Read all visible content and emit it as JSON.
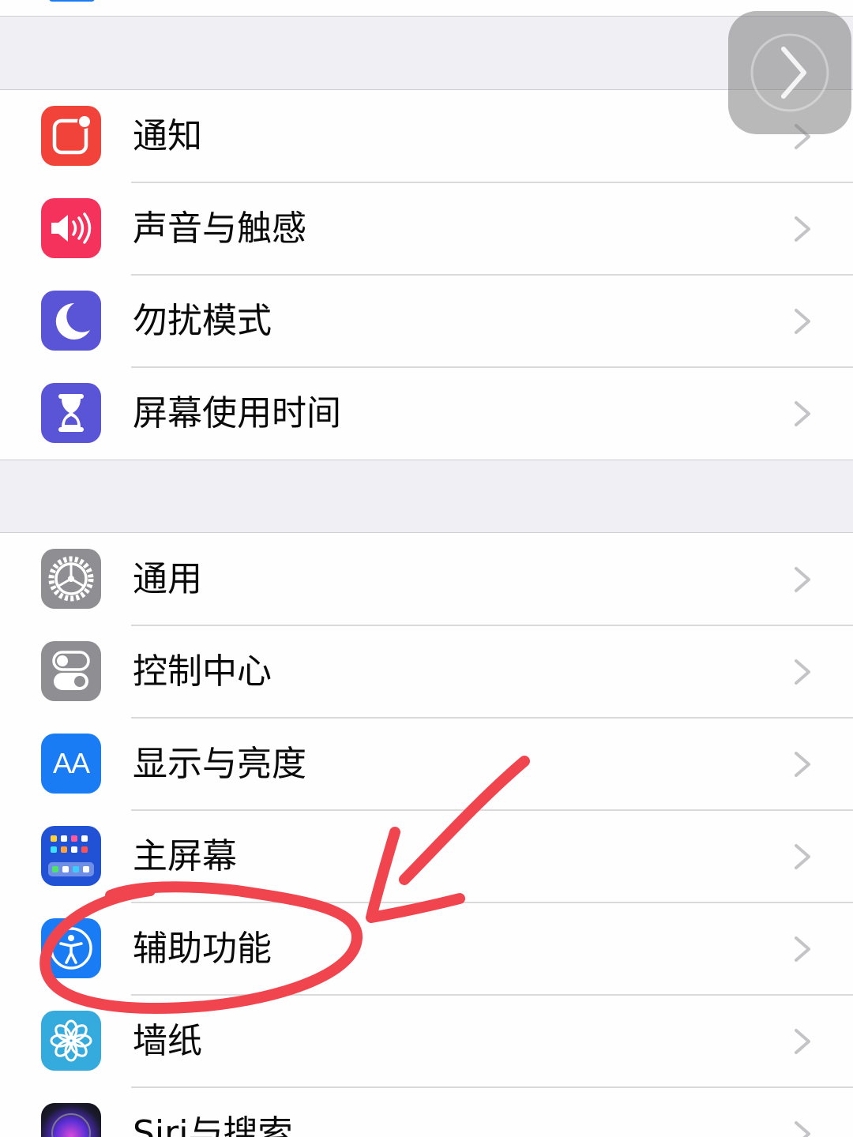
{
  "groups": [
    {
      "rows": [
        {
          "label": "通知",
          "icon": "notifications-icon",
          "color": "#f2433a"
        },
        {
          "label": "声音与触感",
          "icon": "speaker-icon",
          "color": "#f5325b"
        },
        {
          "label": "勿扰模式",
          "icon": "moon-icon",
          "color": "#5a55d6"
        },
        {
          "label": "屏幕使用时间",
          "icon": "hourglass-icon",
          "color": "#5a55d6"
        }
      ]
    },
    {
      "rows": [
        {
          "label": "通用",
          "icon": "gear-icon",
          "color": "#8e8e93"
        },
        {
          "label": "控制中心",
          "icon": "toggles-icon",
          "color": "#8e8e93"
        },
        {
          "label": "显示与亮度",
          "icon": "text-size-icon",
          "color": "#1a7cf5",
          "icon_text": "AA"
        },
        {
          "label": "主屏幕",
          "icon": "home-screen-grid-icon",
          "color": "#2152d6"
        },
        {
          "label": "辅助功能",
          "icon": "accessibility-icon",
          "color": "#1a7cf5"
        },
        {
          "label": "墙纸",
          "icon": "flower-icon",
          "color": "#35aadc"
        },
        {
          "label": "Siri与搜索",
          "icon": "siri-icon",
          "color": "#222222"
        }
      ]
    }
  ],
  "annotation": {
    "color": "#f0454f",
    "highlighted_item": "辅助功能"
  }
}
